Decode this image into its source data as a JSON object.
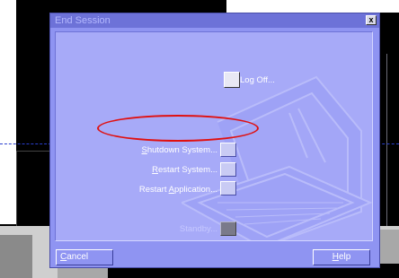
{
  "dialog": {
    "title": "End Session",
    "close_label": "x"
  },
  "options": {
    "log_off": "Log Off...",
    "shutdown_prefix": "S",
    "shutdown_rest": "hutdown System...",
    "restart_system_prefix": "R",
    "restart_system_rest": "estart System...",
    "restart_app_pre": "Restart ",
    "restart_app_u": "A",
    "restart_app_rest": "pplication...",
    "standby": "Standby..."
  },
  "buttons": {
    "cancel_u": "C",
    "cancel_rest": "ancel",
    "help_u": "H",
    "help_rest": "elp"
  }
}
